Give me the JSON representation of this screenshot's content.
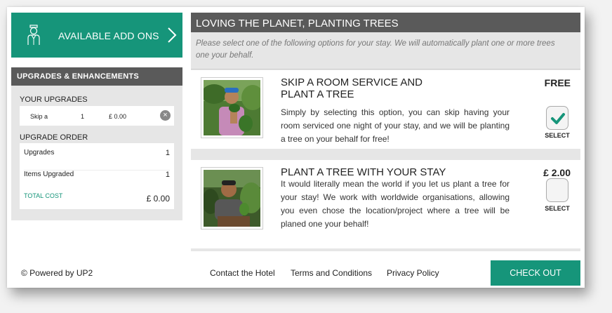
{
  "addons": {
    "label": "AVAILABLE ADD ONS",
    "icon": "concierge-icon"
  },
  "upgrades": {
    "header": "UPGRADES & ENHANCEMENTS",
    "your_upgrades_label": "YOUR UPGRADES",
    "item": {
      "name": "Skip a",
      "qty": "1",
      "price": "£ 0.00"
    },
    "upgrade_order_label": "UPGRADE ORDER",
    "order": {
      "upgrades_label": "Upgrades",
      "upgrades_value": "1",
      "items_label": "Items Upgraded",
      "items_value": "1",
      "total_label": "TOTAL COST",
      "total_value": "£ 0.00"
    }
  },
  "main": {
    "title": "LOVING THE PLANET, PLANTING TREES",
    "intro": "Please select one of the following options for your stay. We will automatically plant one or more trees one your behalf.",
    "options": [
      {
        "title": "SKIP A ROOM SERVICE AND PLANT A TREE",
        "description": "Simply by selecting this option, you can skip having your room serviced one night of your stay, and we will be planting a tree on your behalf for free!",
        "price": "FREE",
        "selected": true,
        "select_label": "SELECT"
      },
      {
        "title": "PLANT A TREE WITH YOUR STAY",
        "description": "It would literally mean the world if you let us plant a tree for your stay! We work with worldwide organisations, allowing you even chose the location/project where a tree will be planed one your behalf!",
        "price": "£ 2.00",
        "selected": false,
        "select_label": "SELECT"
      }
    ]
  },
  "footer": {
    "powered": "© Powered by UP2",
    "links": [
      "Contact the Hotel",
      "Terms and Conditions",
      "Privacy Policy"
    ],
    "checkout": "CHECK OUT"
  },
  "colors": {
    "accent": "#16957a",
    "header": "#5a5a5a",
    "panel": "#e6e6e6"
  }
}
